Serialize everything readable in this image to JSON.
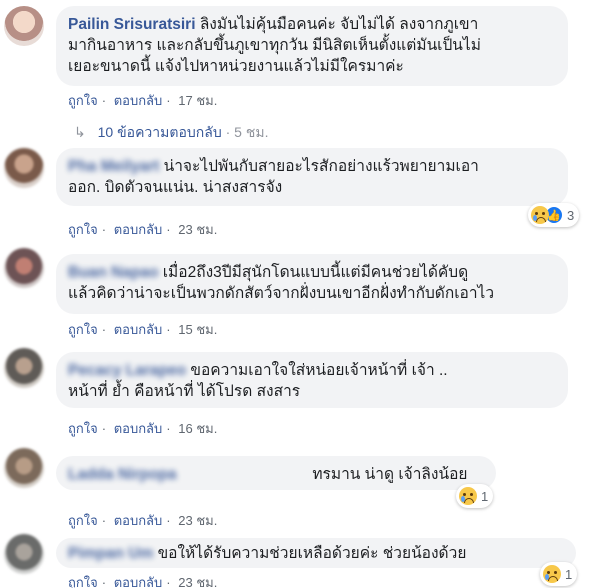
{
  "comments": [
    {
      "author": "Pailin Srisuratsiri",
      "line1": "ลิงมันไม่คุ้นมือคนค่ะ จับไม่ได้ ลงจากภูเขา",
      "line2": "มากินอาหาร และกลับขึ้นภูเขาทุกวัน มีนิสิตเห็นตั้งแต่มันเป็นไม่",
      "line3": "เยอะขนาดนี้ แจ้งไปหาหน่วยงานแล้วไม่มีใครมาค่ะ",
      "like": "ถูกใจ",
      "reply": "ตอบกลับ",
      "time": "17 ชม."
    },
    {
      "author": "Pha Meilyart",
      "line1": "น่าจะไปพันกับสายอะไรสักอย่างแร้วพยายามเอา",
      "line2": "ออก. บิดตัวจนแน่น. น่าสงสารจัง",
      "like": "ถูกใจ",
      "reply": "ตอบกลับ",
      "time": "23 ชม.",
      "reactions": "3"
    },
    {
      "author": "Buan Napao",
      "line1": "เมื่อ2ถึง3ปีมีสุนักโดนแบบนี้แต่มีคนช่วยได้คับดู",
      "line2": "แล้วคิดว่าน่าจะเป็นพวกดักสัตว์จากฝั่งบนเขาอีกฝั่งทำกับดักเอาไว",
      "like": "ถูกใจ",
      "reply": "ตอบกลับ",
      "time": "15 ชม."
    },
    {
      "author": "Pecacy Larapeo",
      "line1": "ขอความเอาใจใส่หน่อยเจ้าหน้าที่ เจ้า ..",
      "line2": "หน้าที่ ย้ำ คือหน้าที่ ได้โปรด สงสาร",
      "like": "ถูกใจ",
      "reply": "ตอบกลับ",
      "time": "16 ชม."
    },
    {
      "author": "Ladda Nirpopa",
      "line1": "ทรมาน น่าดู เจ้าลิงน้อย",
      "like": "ถูกใจ",
      "reply": "ตอบกลับ",
      "time": "23 ชม.",
      "reactions": "1"
    },
    {
      "author": "Pimpan Um",
      "line1": "ขอให้ได้รับความช่วยเหลือด้วยค่ะ ช่วยน้องด้วย",
      "like": "ถูกใจ",
      "reply": "ตอบกลับ",
      "time": "23 ชม.",
      "reactions": "1"
    }
  ],
  "replies_link": {
    "label": "10 ข้อความตอบกลับ",
    "time": "5 ชม."
  },
  "colors": {
    "link": "#385898",
    "bubble": "#f2f3f5",
    "meta": "#606770"
  },
  "icons": [
    "reply-arrow-icon",
    "sad-reaction-icon",
    "like-reaction-icon"
  ]
}
